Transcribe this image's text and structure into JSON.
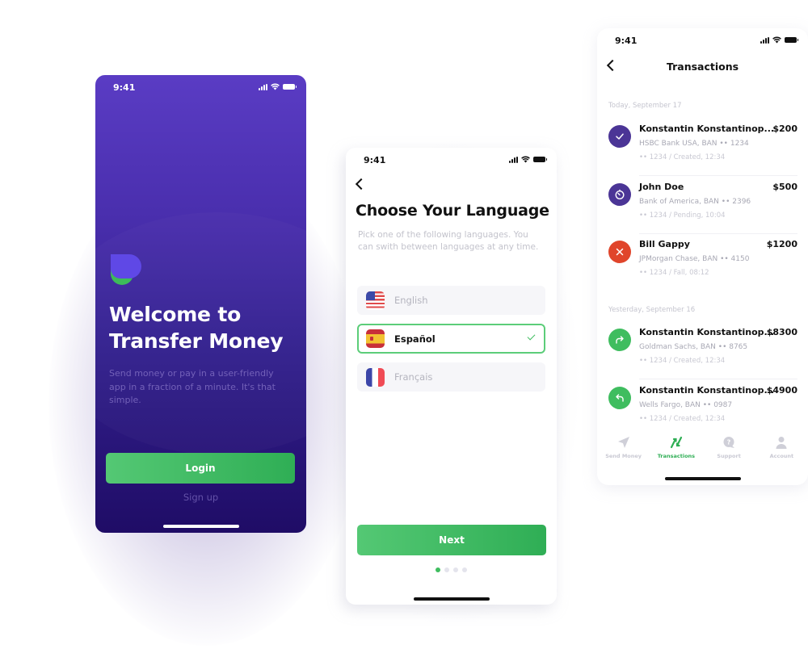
{
  "welcome_screen": {
    "status_time": "9:41",
    "title_line1": "Welcome to",
    "title_line2": "Transfer Money",
    "subtitle": "Send money or pay in a user-friendly app in a fraction of a minute. It's that simple.",
    "login_label": "Login",
    "signup_label": "Sign up",
    "logo_icon": "app-logo-icon",
    "colors": {
      "accent": "#2fae55",
      "background_top": "#5a3cc4",
      "background_bottom": "#1f0c66"
    }
  },
  "language_screen": {
    "status_time": "9:41",
    "back_icon": "chevron-left-icon",
    "title": "Choose Your Language",
    "subtitle": "Pick one of the following languages. You can swith between languages at any time.",
    "options": [
      {
        "label": "English",
        "flag": "us-flag-icon",
        "selected": false
      },
      {
        "label": "Español",
        "flag": "es-flag-icon",
        "selected": true
      },
      {
        "label": "Français",
        "flag": "fr-flag-icon",
        "selected": false
      }
    ],
    "next_label": "Next",
    "pagination": {
      "current": 1,
      "total": 4
    }
  },
  "transactions_screen": {
    "status_time": "9:41",
    "back_icon": "chevron-left-icon",
    "title": "Transactions",
    "sections": [
      {
        "label": "Today, September 17",
        "items": [
          {
            "name": "Konstantin Konstantinop...",
            "amount": "$200",
            "bank": "HSBC Bank USA, BAN •• 1234",
            "meta": "•• 1234 / Created, 12:34",
            "status_icon": "check-icon",
            "color": "#4b3596"
          },
          {
            "name": "John Doe",
            "amount": "$500",
            "bank": "Bank of America, BAN •• 2396",
            "meta": "•• 1234 / Pending, 10:04",
            "status_icon": "timer-icon",
            "color": "#4b3596"
          },
          {
            "name": "Bill Gappy",
            "amount": "$1200",
            "bank": "JPMorgan Chase, BAN •• 4150",
            "meta": "•• 1234 / Fall, 08:12",
            "status_icon": "close-icon",
            "color": "#e0452b"
          }
        ]
      },
      {
        "label": "Yesterday, September 16",
        "items": [
          {
            "name": "Konstantin Konstantinop...",
            "amount": "$8300",
            "bank": "Goldman Sachs, BAN •• 8765",
            "meta": "•• 1234 / Created, 12:34",
            "status_icon": "forward-arrow-icon",
            "color": "#3fbd5f"
          },
          {
            "name": "Konstantin Konstantinop...",
            "amount": "$4900",
            "bank": "Wells Fargo, BAN •• 0987",
            "meta": "•• 1234 / Created, 12:34",
            "status_icon": "reply-arrow-icon",
            "color": "#3fbd5f"
          }
        ]
      }
    ],
    "tabs": [
      {
        "label": "Send Money",
        "icon": "send-icon",
        "active": false
      },
      {
        "label": "Transactions",
        "icon": "transactions-icon",
        "active": true
      },
      {
        "label": "Support",
        "icon": "support-icon",
        "active": false
      },
      {
        "label": "Account",
        "icon": "account-icon",
        "active": false
      }
    ]
  }
}
